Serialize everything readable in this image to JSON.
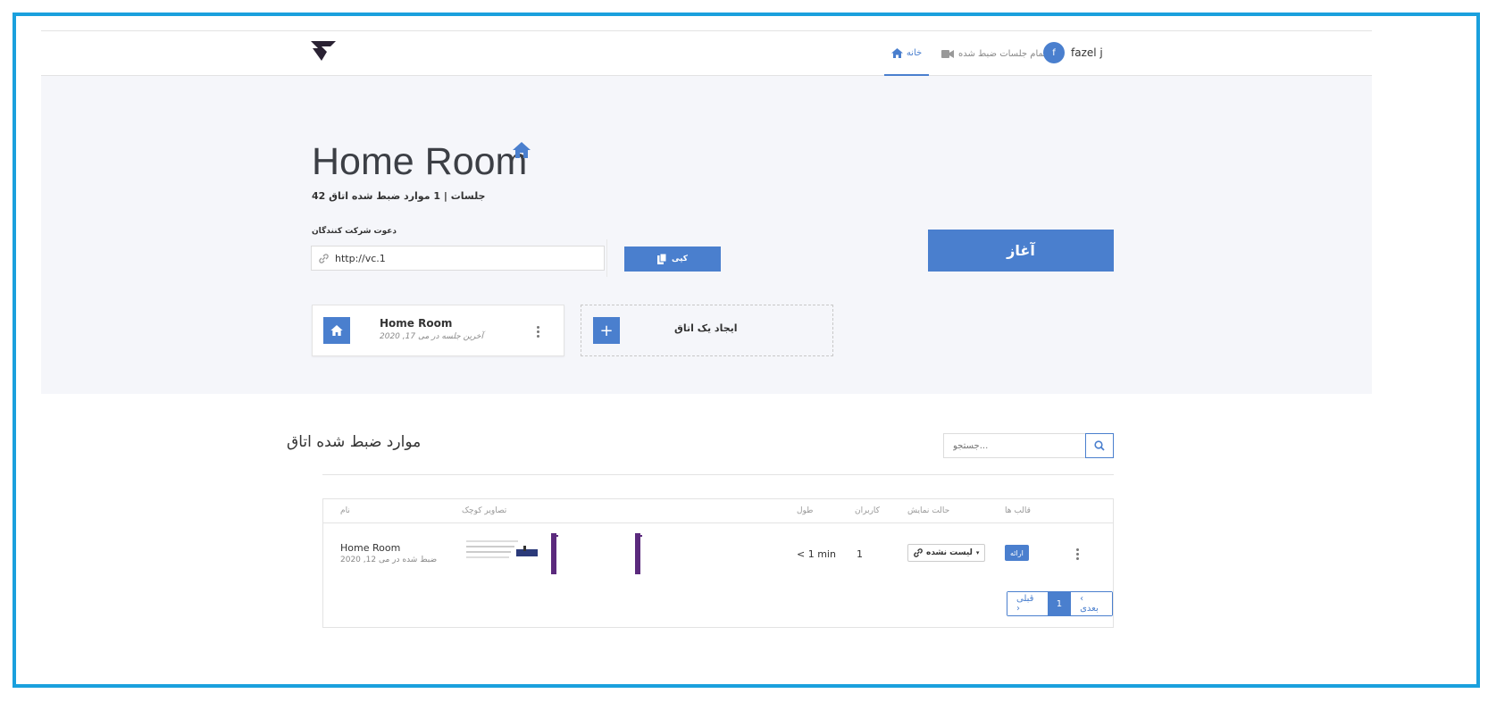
{
  "nav": {
    "home_label": "خانه",
    "recordings_label": "تمام جلسات ضبط شده",
    "user_initial": "f",
    "user_name": "fazel j"
  },
  "room": {
    "title": "Home Room",
    "subtitle": "جلسات | 1 موارد ضبط شده اتاق 42",
    "invite_label": "دعوت شرکت کنندگان",
    "invite_url": "http://vc.1",
    "copy_label": "کپی",
    "start_label": "آغاز"
  },
  "cards": {
    "room_name": "Home Room",
    "room_last_session": "آخرین جلسه در می 17, 2020",
    "create_label": "ایجاد یک اتاق"
  },
  "recordings": {
    "title": "موارد ضبط شده اتاق",
    "search_placeholder": "جستجو...",
    "columns": {
      "name": "نام",
      "thumbnails": "تصاویر کوچک",
      "length": "طول",
      "users": "کاربران",
      "visibility": "حالت نمایش",
      "formats": "قالب ها"
    },
    "rows": [
      {
        "name": "Home Room",
        "date": "ضبط شده در می 12, 2020",
        "length": "< 1 min",
        "users": "1",
        "visibility": "لیست نشده",
        "format": "ارائه"
      }
    ],
    "pager": {
      "next": "‹ بعدی",
      "page": "1",
      "prev": "قبلی ›"
    }
  },
  "colors": {
    "accent": "#4a7fce",
    "frame": "#1aa0dd",
    "hero_bg": "#f5f6fa"
  }
}
